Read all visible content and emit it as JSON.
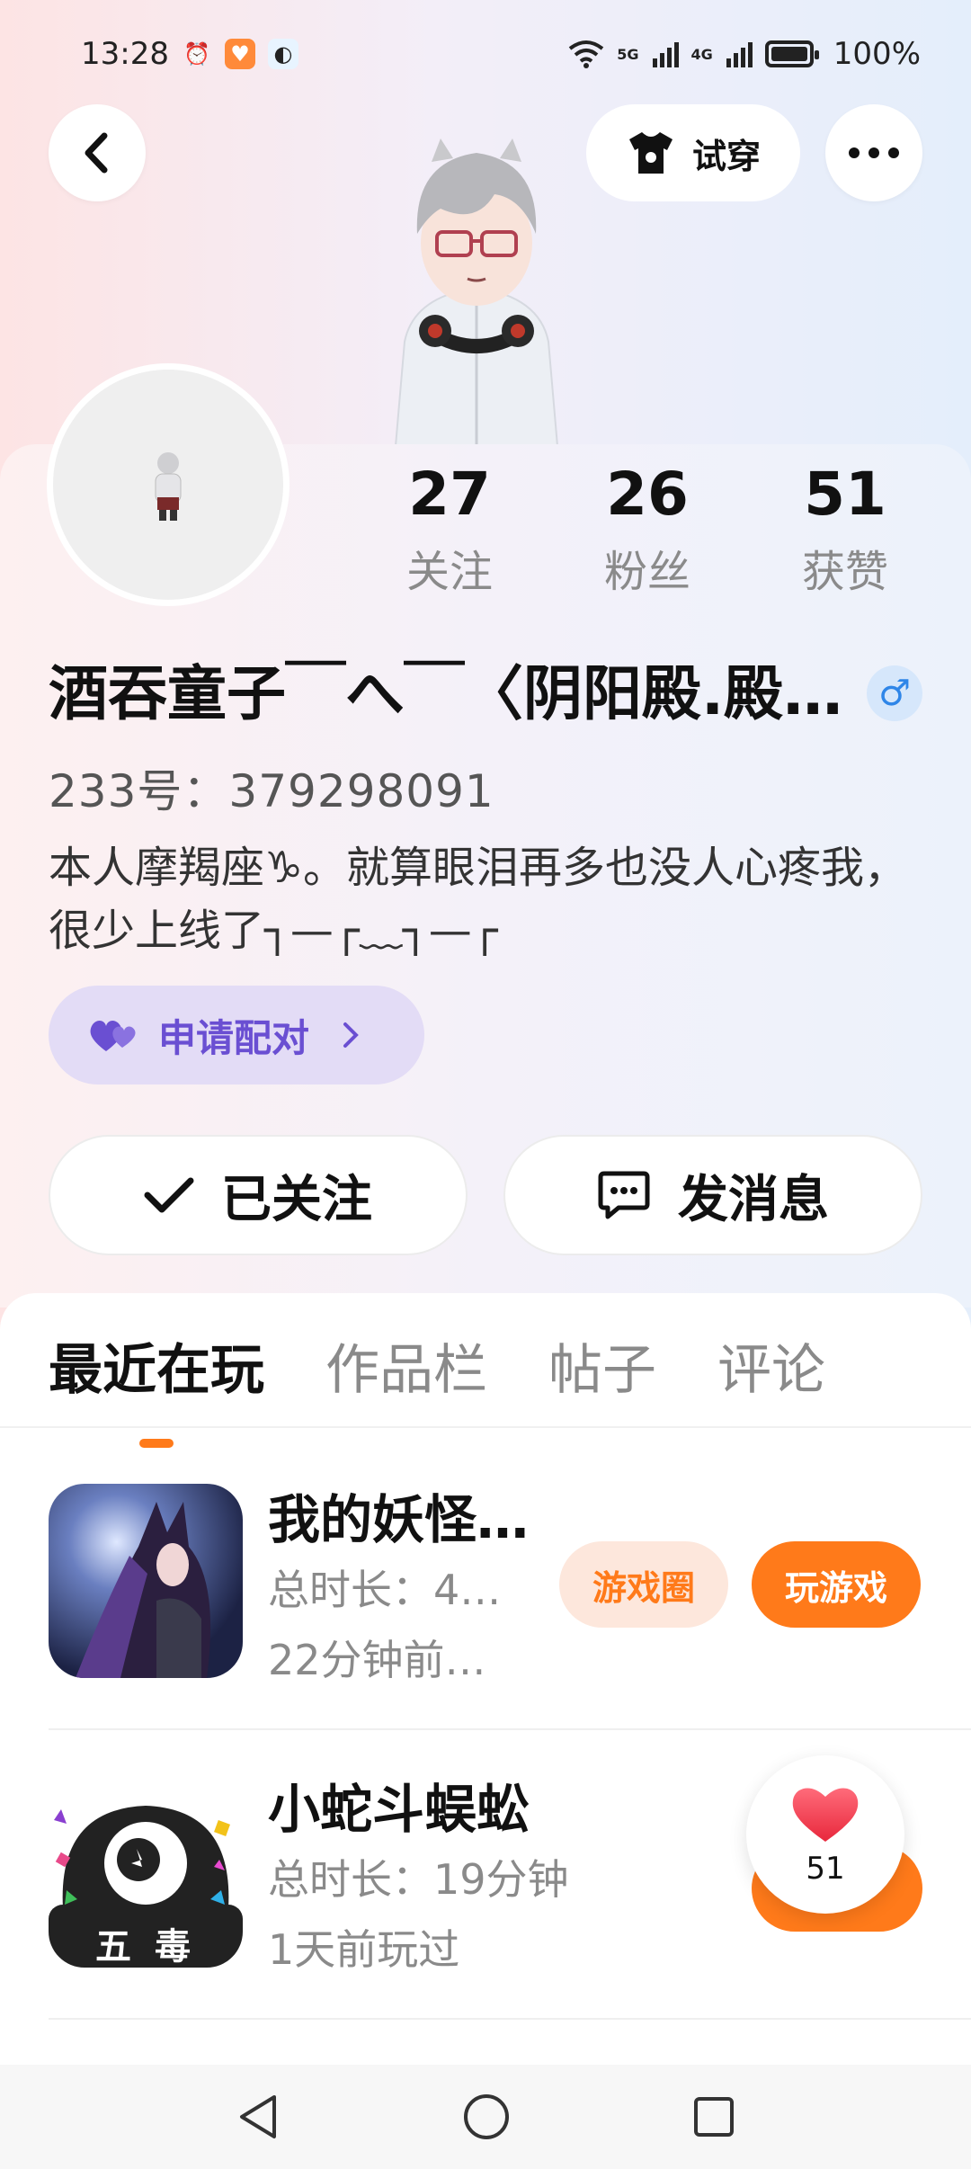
{
  "status_bar": {
    "time": "13:28",
    "network_5g": "5G",
    "network_4g": "4G",
    "battery": "100%"
  },
  "header": {
    "try_on_label": "试穿"
  },
  "profile": {
    "stats": [
      {
        "value": "27",
        "label": "关注"
      },
      {
        "value": "26",
        "label": "粉丝"
      },
      {
        "value": "51",
        "label": "获赞"
      }
    ],
    "nickname": "酒吞童子￣へ￣〈阴阳殿.殿…",
    "gender_symbol": "♂",
    "uid": "233号：379298091",
    "bio": "本人摩羯座♑。就算眼泪再多也没人心疼我，很少上线了┐—┌﹏┐—┌",
    "pair_button": "申请配对",
    "follow_button": "已关注",
    "message_button": "发消息"
  },
  "tabs": [
    {
      "label": "最近在玩",
      "active": true
    },
    {
      "label": "作品栏",
      "active": false
    },
    {
      "label": "帖子",
      "active": false
    },
    {
      "label": "评论",
      "active": false
    }
  ],
  "games": [
    {
      "name": "我的妖怪…",
      "duration": "总时长：4…",
      "last_played": "22分钟前…",
      "group_button": "游戏圈",
      "play_button": "玩游戏"
    },
    {
      "name": "小蛇斗蜈蚣",
      "duration": "总时长：19分钟",
      "last_played": "1天前玩过",
      "icon_text": "五 毒"
    }
  ],
  "like_float": {
    "count": "51"
  },
  "colors": {
    "accent": "#ff7a1a",
    "pair_purple": "#6a4fd2",
    "gender_blue": "#2f86e8"
  }
}
